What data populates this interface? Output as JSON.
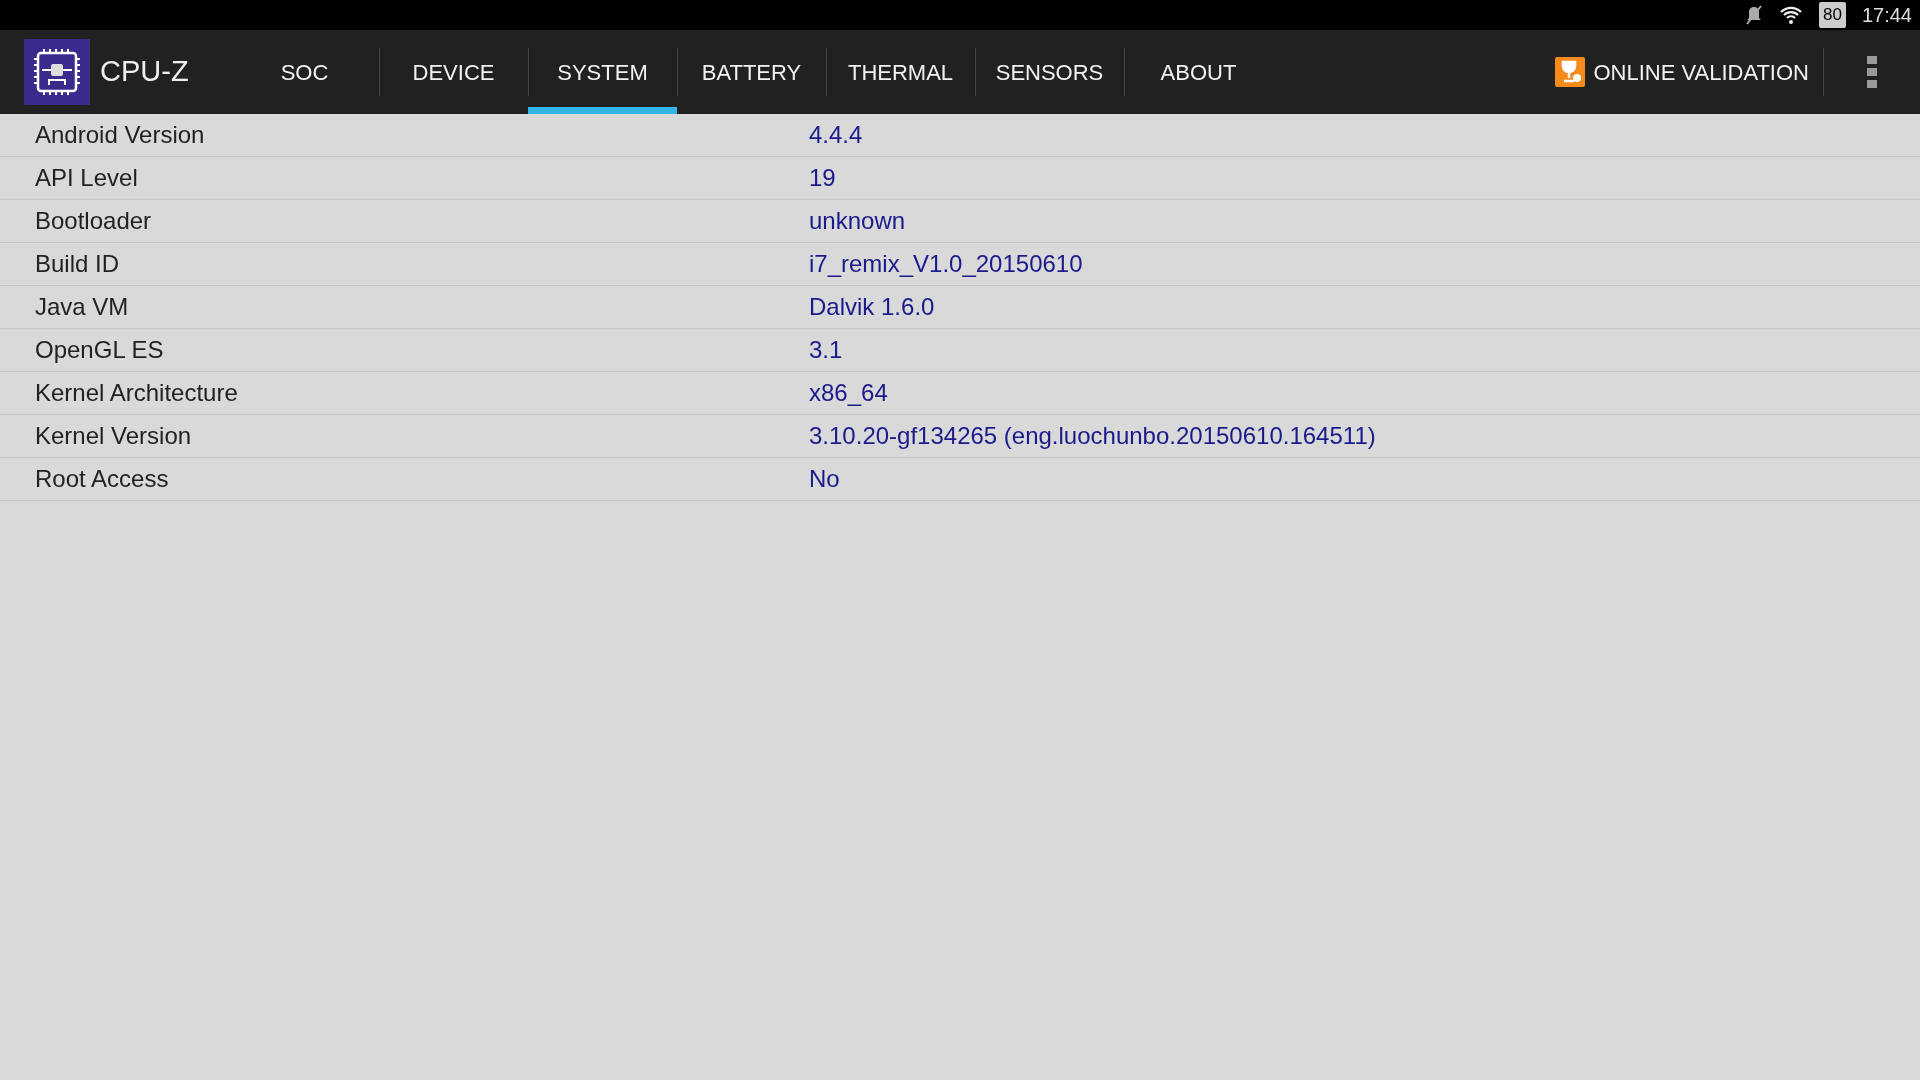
{
  "status_bar": {
    "battery": "80",
    "time": "17:44"
  },
  "app": {
    "title": "CPU-Z"
  },
  "tabs": [
    {
      "label": "SOC",
      "selected": false
    },
    {
      "label": "DEVICE",
      "selected": false
    },
    {
      "label": "SYSTEM",
      "selected": true
    },
    {
      "label": "BATTERY",
      "selected": false
    },
    {
      "label": "THERMAL",
      "selected": false
    },
    {
      "label": "SENSORS",
      "selected": false
    },
    {
      "label": "ABOUT",
      "selected": false
    }
  ],
  "validation_button": {
    "label": "ONLINE VALIDATION"
  },
  "rows": [
    {
      "label": "Android Version",
      "value": "4.4.4"
    },
    {
      "label": "API Level",
      "value": "19"
    },
    {
      "label": "Bootloader",
      "value": "unknown"
    },
    {
      "label": "Build ID",
      "value": "i7_remix_V1.0_20150610"
    },
    {
      "label": "Java VM",
      "value": "Dalvik 1.6.0"
    },
    {
      "label": "OpenGL ES",
      "value": "3.1"
    },
    {
      "label": "Kernel Architecture",
      "value": "x86_64"
    },
    {
      "label": "Kernel Version",
      "value": "3.10.20-gf134265 (eng.luochunbo.20150610.164511)"
    },
    {
      "label": "Root Access",
      "value": "No"
    }
  ]
}
